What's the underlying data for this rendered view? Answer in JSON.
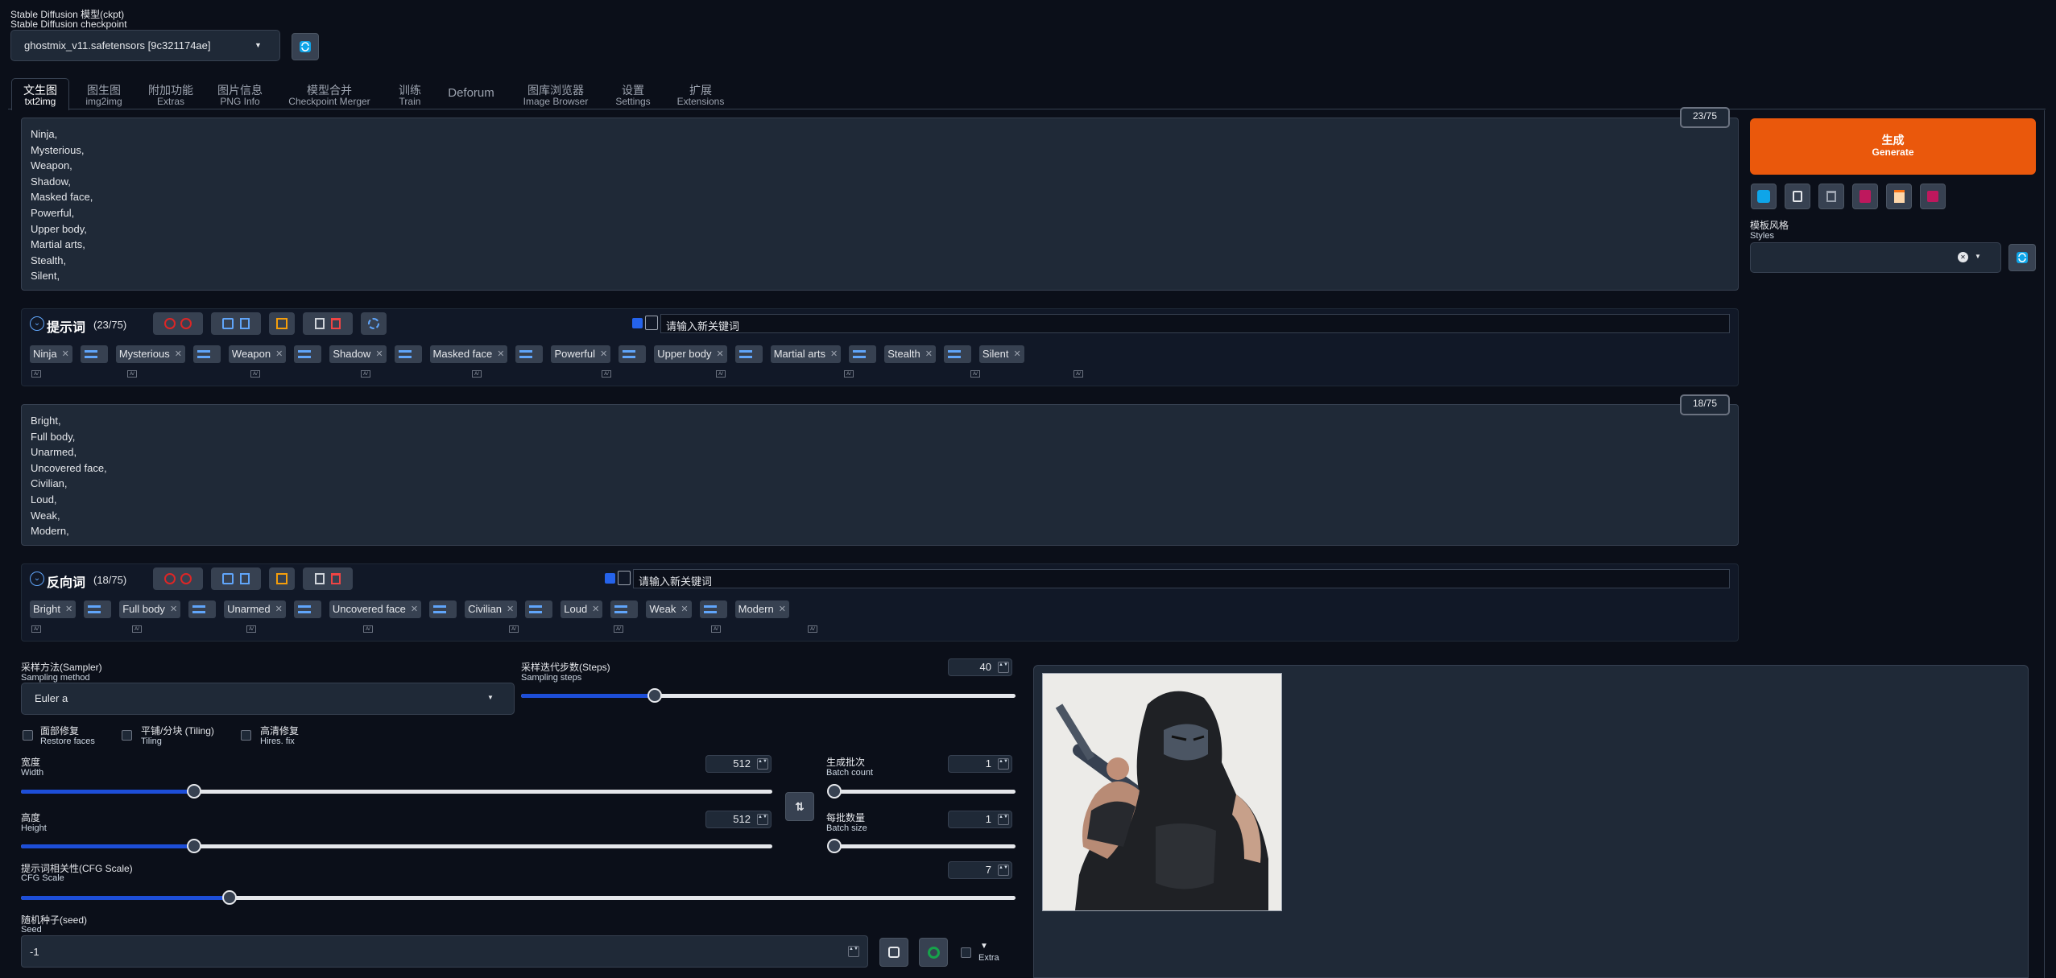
{
  "checkpoint": {
    "label_zh": "Stable Diffusion 模型(ckpt)",
    "label_en": "Stable Diffusion checkpoint",
    "value": "ghostmix_v11.safetensors [9c321174ae]"
  },
  "tabs": [
    {
      "zh": "文生图",
      "en": "txt2img",
      "active": true
    },
    {
      "zh": "图生图",
      "en": "img2img"
    },
    {
      "zh": "附加功能",
      "en": "Extras"
    },
    {
      "zh": "图片信息",
      "en": "PNG Info"
    },
    {
      "zh": "模型合并",
      "en": "Checkpoint Merger"
    },
    {
      "zh": "训练",
      "en": "Train"
    },
    {
      "zh": "Deforum",
      "en": ""
    },
    {
      "zh": "图库浏览器",
      "en": "Image Browser"
    },
    {
      "zh": "设置",
      "en": "Settings"
    },
    {
      "zh": "扩展",
      "en": "Extensions"
    }
  ],
  "prompt": {
    "counter": "23/75",
    "text": "Ninja,\nMysterious,\nWeapon,\nShadow,\nMasked face,\nPowerful,\nUpper body,\nMartial arts,\nStealth,\nSilent,",
    "header_title": "提示词",
    "header_count": "(23/75)",
    "new_keyword_placeholder": "请输入新关键词",
    "tags": [
      "Ninja",
      "Mysterious",
      "Weapon",
      "Shadow",
      "Masked face",
      "Powerful",
      "Upper body",
      "Martial arts",
      "Stealth",
      "Silent"
    ]
  },
  "negative": {
    "counter": "18/75",
    "text": "Bright,\nFull body,\nUnarmed,\nUncovered face,\nCivilian,\nLoud,\nWeak,\nModern,",
    "header_title": "反向词",
    "header_count": "(18/75)",
    "new_keyword_placeholder": "请输入新关键词",
    "tags": [
      "Bright",
      "Full body",
      "Unarmed",
      "Uncovered face",
      "Civilian",
      "Loud",
      "Weak",
      "Modern"
    ]
  },
  "generate": {
    "zh": "生成",
    "en": "Generate",
    "color": "#ea580c"
  },
  "styles": {
    "label_zh": "模板风格",
    "label_en": "Styles",
    "clear_glyph": "✕"
  },
  "sampler": {
    "label_zh": "采样方法(Sampler)",
    "label_en": "Sampling method",
    "value": "Euler a"
  },
  "steps": {
    "label_zh": "采样迭代步数(Steps)",
    "label_en": "Sampling steps",
    "value": "40",
    "fraction": 0.27
  },
  "options": {
    "restore_faces": {
      "zh": "面部修复",
      "en": "Restore faces"
    },
    "tiling": {
      "zh": "平铺/分块 (Tiling)",
      "en": "Tiling"
    },
    "hires": {
      "zh": "高清修复",
      "en": "Hires. fix"
    }
  },
  "width": {
    "label_zh": "宽度",
    "label_en": "Width",
    "value": "512",
    "fraction": 0.23
  },
  "height": {
    "label_zh": "高度",
    "label_en": "Height",
    "value": "512",
    "fraction": 0.23
  },
  "batch_count": {
    "label_zh": "生成批次",
    "label_en": "Batch count",
    "value": "1",
    "fraction": 0.0
  },
  "batch_size": {
    "label_zh": "每批数量",
    "label_en": "Batch size",
    "value": "1",
    "fraction": 0.0
  },
  "cfg": {
    "label_zh": "提示词相关性(CFG Scale)",
    "label_en": "CFG Scale",
    "value": "7",
    "fraction": 0.21
  },
  "seed": {
    "label_zh": "随机种子(seed)",
    "label_en": "Seed",
    "value": "-1",
    "extra_label": "Extra",
    "extra_arrow": "▼"
  },
  "swap_glyph": "⇅",
  "accent": "#1d4ed8"
}
